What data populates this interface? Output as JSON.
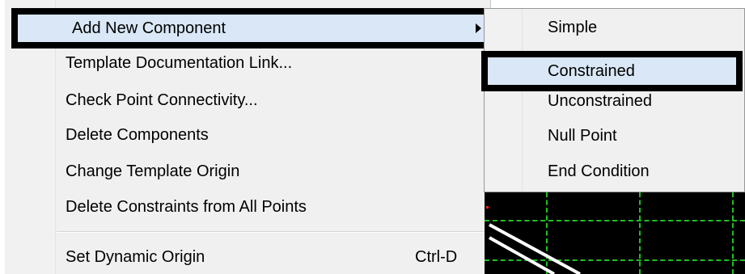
{
  "menu": {
    "items": [
      {
        "label": "Add New Component",
        "has_submenu": true
      },
      {
        "label": "Template Documentation Link..."
      },
      {
        "label": "Check Point Connectivity..."
      },
      {
        "label": "Delete Components"
      },
      {
        "label": "Change Template Origin"
      },
      {
        "label": "Delete Constraints from All Points"
      },
      {
        "label": "Set Dynamic Origin",
        "shortcut": "Ctrl-D"
      }
    ]
  },
  "submenu": {
    "items": [
      {
        "label": "Simple"
      },
      {
        "label": "Constrained"
      },
      {
        "label": "Unconstrained"
      },
      {
        "label": "Null Point"
      },
      {
        "label": "End Condition"
      }
    ]
  },
  "colors": {
    "menu_bg": "#f0f0f0",
    "highlight_bg": "#d9e7f6",
    "highlight_border": "#000000",
    "canvas_bg": "#000000",
    "grid": "#1fbf1f",
    "lines": "#ffffff"
  }
}
